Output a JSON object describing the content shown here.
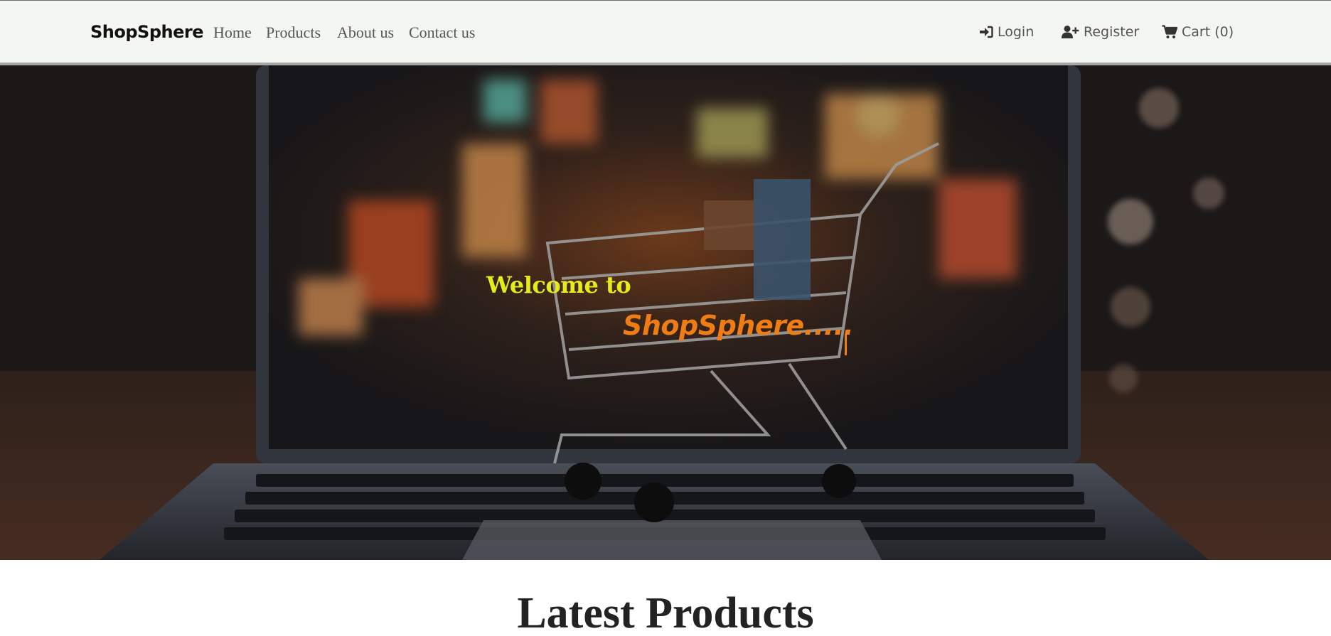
{
  "navbar": {
    "brand": "ShopSphere",
    "links": [
      {
        "label": "Home"
      },
      {
        "label": "Products"
      },
      {
        "label": "About us"
      },
      {
        "label": "Contact us"
      }
    ],
    "login": {
      "label": "Login",
      "icon": "sign-in-icon"
    },
    "register": {
      "label": "Register",
      "icon": "user-plus-icon"
    },
    "cart": {
      "label": "Cart (0)",
      "icon": "shopping-cart-icon"
    }
  },
  "hero": {
    "welcome": "Welcome to",
    "brand": "ShopSphere.....",
    "background": "shopping cart on laptop keyboard",
    "colors": {
      "welcome": "#e4ec1b",
      "brand": "#f07d14"
    }
  },
  "main": {
    "section_title": "Latest Products"
  }
}
